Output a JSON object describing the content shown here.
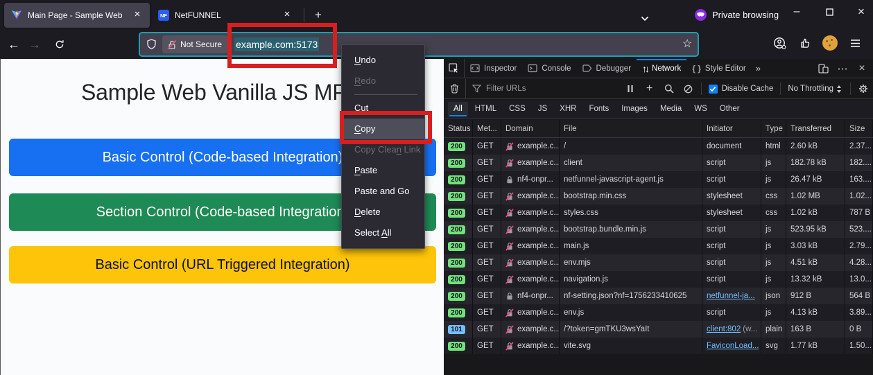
{
  "colors": {
    "accent_blue": "#0a84ff",
    "focus_teal": "#1a9fb4",
    "status_green": "#70e17b",
    "status_blue": "#75bfff",
    "link_blue": "#75bfff",
    "annotation_red": "#d81f1f",
    "private_purple": "#8a2be2"
  },
  "browser": {
    "tabs": [
      {
        "title": "Main Page - Sample Web"
      },
      {
        "title": "NetFUNNEL"
      }
    ],
    "private_label": "Private browsing",
    "urlbar": {
      "not_secure": "Not Secure",
      "selected_text": "example.com:5173"
    }
  },
  "page": {
    "heading": "Sample Web Vanilla JS MP",
    "buttons": [
      {
        "label": "Basic Control (Code-based Integration)",
        "bg": "#176ff2",
        "fg": "#ffffff"
      },
      {
        "label": "Section Control (Code-based Integration)",
        "bg": "#1e8a55",
        "fg": "#ffffff"
      },
      {
        "label": "Basic Control (URL Triggered Integration)",
        "bg": "#fdc40a",
        "fg": "#111111"
      }
    ]
  },
  "context_menu": {
    "items": [
      {
        "pre": "",
        "key": "U",
        "post": "ndo"
      },
      {
        "pre": "",
        "key": "R",
        "post": "edo",
        "disabled": true
      },
      {
        "separator": true
      },
      {
        "pre": "Cu",
        "key": "t",
        "post": ""
      },
      {
        "pre": "",
        "key": "C",
        "post": "opy",
        "highlighted": true
      },
      {
        "pre": "Copy Clea",
        "key": "n",
        "post": " Link",
        "disabled": true
      },
      {
        "pre": "",
        "key": "P",
        "post": "aste"
      },
      {
        "pre": "Paste and Go",
        "key": "",
        "post": ""
      },
      {
        "pre": "",
        "key": "D",
        "post": "elete"
      },
      {
        "pre": "Select ",
        "key": "A",
        "post": "ll"
      }
    ]
  },
  "devtools": {
    "tabs": [
      {
        "label": "Inspector",
        "icon": "inspector"
      },
      {
        "label": "Console",
        "icon": "console"
      },
      {
        "label": "Debugger",
        "icon": "debugger"
      },
      {
        "label": "Network",
        "icon": "network",
        "active": true
      },
      {
        "label": "Style Editor",
        "icon": "styleeditor"
      }
    ],
    "toolbar": {
      "filter_placeholder": "Filter URLs",
      "disable_cache_label": "Disable Cache",
      "throttling_label": "No Throttling"
    },
    "filters": [
      "All",
      "HTML",
      "CSS",
      "JS",
      "XHR",
      "Fonts",
      "Images",
      "Media",
      "WS",
      "Other"
    ],
    "active_filter": "All",
    "columns": [
      "Status",
      "Met...",
      "Domain",
      "File",
      "Initiator",
      "Type",
      "Transferred",
      "Size"
    ],
    "requests": [
      {
        "status": "200",
        "status_color": "green",
        "method": "GET",
        "domain": "example.c...",
        "lock": "insecure",
        "file": "/",
        "initiator": "document",
        "type": "html",
        "transferred": "2.60 kB",
        "size": "2.37..."
      },
      {
        "status": "200",
        "status_color": "green",
        "method": "GET",
        "domain": "example.c...",
        "lock": "insecure",
        "file": "client",
        "initiator": "script",
        "type": "js",
        "transferred": "182.78 kB",
        "size": "182...."
      },
      {
        "status": "200",
        "status_color": "green",
        "method": "GET",
        "domain": "nf4-onpr...",
        "lock": "secure",
        "file": "netfunnel-javascript-agent.js",
        "initiator": "script",
        "type": "js",
        "transferred": "26.47 kB",
        "size": "163...."
      },
      {
        "status": "200",
        "status_color": "green",
        "method": "GET",
        "domain": "example.c...",
        "lock": "insecure",
        "file": "bootstrap.min.css",
        "initiator": "stylesheet",
        "type": "css",
        "transferred": "1.02 MB",
        "size": "1.02..."
      },
      {
        "status": "200",
        "status_color": "green",
        "method": "GET",
        "domain": "example.c...",
        "lock": "insecure",
        "file": "styles.css",
        "initiator": "stylesheet",
        "type": "css",
        "transferred": "1.02 kB",
        "size": "787 B"
      },
      {
        "status": "200",
        "status_color": "green",
        "method": "GET",
        "domain": "example.c...",
        "lock": "insecure",
        "file": "bootstrap.bundle.min.js",
        "initiator": "script",
        "type": "js",
        "transferred": "523.95 kB",
        "size": "523...."
      },
      {
        "status": "200",
        "status_color": "green",
        "method": "GET",
        "domain": "example.c...",
        "lock": "insecure",
        "file": "main.js",
        "initiator": "script",
        "type": "js",
        "transferred": "3.03 kB",
        "size": "2.79..."
      },
      {
        "status": "200",
        "status_color": "green",
        "method": "GET",
        "domain": "example.c...",
        "lock": "insecure",
        "file": "env.mjs",
        "initiator": "script",
        "type": "js",
        "transferred": "4.51 kB",
        "size": "4.28..."
      },
      {
        "status": "200",
        "status_color": "green",
        "method": "GET",
        "domain": "example.c...",
        "lock": "insecure",
        "file": "navigation.js",
        "initiator": "script",
        "type": "js",
        "transferred": "13.32 kB",
        "size": "13.0..."
      },
      {
        "status": "200",
        "status_color": "green",
        "method": "GET",
        "domain": "nf4-onpr...",
        "lock": "secure",
        "file": "nf-setting.json?nf=1756233410625",
        "initiator": "netfunnel-ja...",
        "initiator_link": true,
        "type": "json",
        "transferred": "912 B",
        "size": "564 B"
      },
      {
        "status": "200",
        "status_color": "green",
        "method": "GET",
        "domain": "example.c...",
        "lock": "insecure",
        "file": "env.js",
        "initiator": "script",
        "type": "js",
        "transferred": "4.13 kB",
        "size": "3.89..."
      },
      {
        "status": "101",
        "status_color": "blue",
        "method": "GET",
        "domain": "example.c...",
        "lock": "insecure",
        "file": "/?token=gmTKU3wsYaIt",
        "initiator": "client:802",
        "initiator_link": true,
        "initiator_suffix": "(w...",
        "type": "plain",
        "transferred": "163 B",
        "size": "0 B"
      },
      {
        "status": "200",
        "status_color": "green",
        "method": "GET",
        "domain": "example.c...",
        "lock": "insecure",
        "file": "vite.svg",
        "initiator": "FaviconLoad...",
        "initiator_link": true,
        "type": "svg",
        "transferred": "1.77 kB",
        "size": "1.50..."
      }
    ]
  }
}
